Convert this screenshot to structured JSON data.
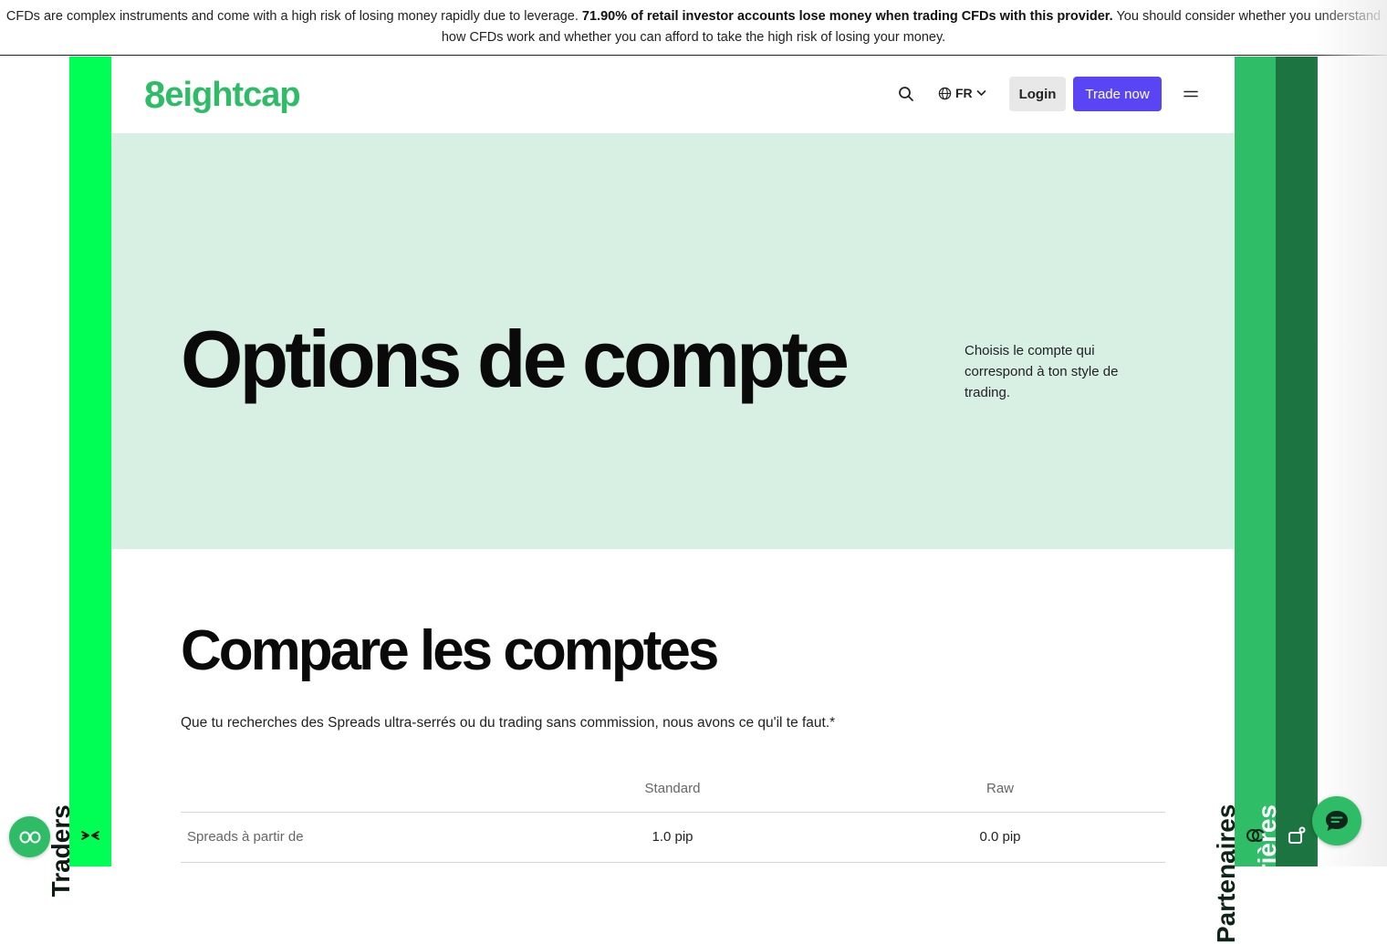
{
  "risk_banner": {
    "text_before": "CFDs are complex instruments and come with a high risk of losing money rapidly due to leverage.",
    "text_bold": "71.90% of retail investor accounts lose money when trading CFDs with this provider.",
    "text_after": "You should consider whether you understand how CFDs work and whether you can afford to take the high risk of losing your money."
  },
  "side_tabs": {
    "traders": "Traders",
    "partners": "Partenaires",
    "careers": "Carrières"
  },
  "header": {
    "logo": "eightcap",
    "logo_mark": "8",
    "language": "FR",
    "login_label": "Login",
    "trade_label": "Trade now"
  },
  "hero": {
    "title": "Options de compte",
    "subtitle": "Choisis le compte qui correspond à ton style de trading."
  },
  "compare": {
    "title": "Compare les comptes",
    "subtitle": "Que tu recherches des Spreads ultra-serrés ou du trading sans commission, nous avons ce qu'il te faut.*",
    "columns": [
      "Standard",
      "Raw"
    ],
    "rows": [
      {
        "label": "Spreads à partir de",
        "values": [
          "1.0 pip",
          "0.0 pip"
        ]
      }
    ]
  },
  "colors": {
    "brand_green": "#2ebd66",
    "traders_tab": "#00ff55",
    "partners_tab": "#2fbd68",
    "careers_tab": "#1c7540",
    "trade_button": "#5a45f5",
    "hero_bg": "#d7f0e3"
  },
  "icons": [
    "search-icon",
    "globe-icon",
    "chevron-down-icon",
    "menu-icon",
    "collapse-arrows-icon",
    "partners-rings-icon",
    "careers-icon",
    "accessibility-icon",
    "chat-icon"
  ]
}
